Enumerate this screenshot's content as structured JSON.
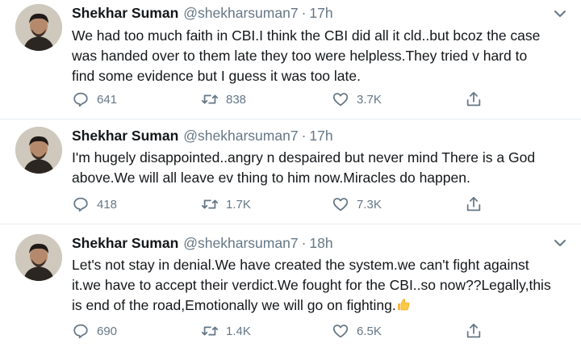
{
  "tweets": [
    {
      "name": "Shekhar Suman",
      "handle": "@shekharsuman7",
      "separator": "·",
      "time": "17h",
      "text": "We had too much faith in CBI.I think the CBI did all it cld..but bcoz the case\nwas handed over to them late they too were helpless.They tried v hard to\nfind some evidence but I guess it was too late.",
      "replies": "641",
      "retweets": "838",
      "likes": "3.7K"
    },
    {
      "name": "Shekhar Suman",
      "handle": "@shekharsuman7",
      "separator": "·",
      "time": "17h",
      "text": "I'm hugely disappointed..angry n despaired but never mind There is a God\nabove.We will all leave ev thing to him now.Miracles do happen.",
      "replies": "418",
      "retweets": "1.7K",
      "likes": "7.3K"
    },
    {
      "name": "Shekhar Suman",
      "handle": "@shekharsuman7",
      "separator": "·",
      "time": "18h",
      "text": "Let's not stay in denial.We have created the system.we can't fight against\nit.we have to accept their verdict.We fought for the CBI..so now??Legally,this\nis end of the road,Emotionally we will go on fighting.",
      "emoji": "thumbs-up",
      "replies": "690",
      "retweets": "1.4K",
      "likes": "6.5K"
    }
  ],
  "icons": {
    "reply": "reply-icon",
    "retweet": "retweet-icon",
    "like": "like-icon",
    "share": "share-icon",
    "menu": "chevron-down-icon"
  },
  "colors": {
    "text": "#14171a",
    "muted": "#657786",
    "divider": "#e6ecf0"
  }
}
